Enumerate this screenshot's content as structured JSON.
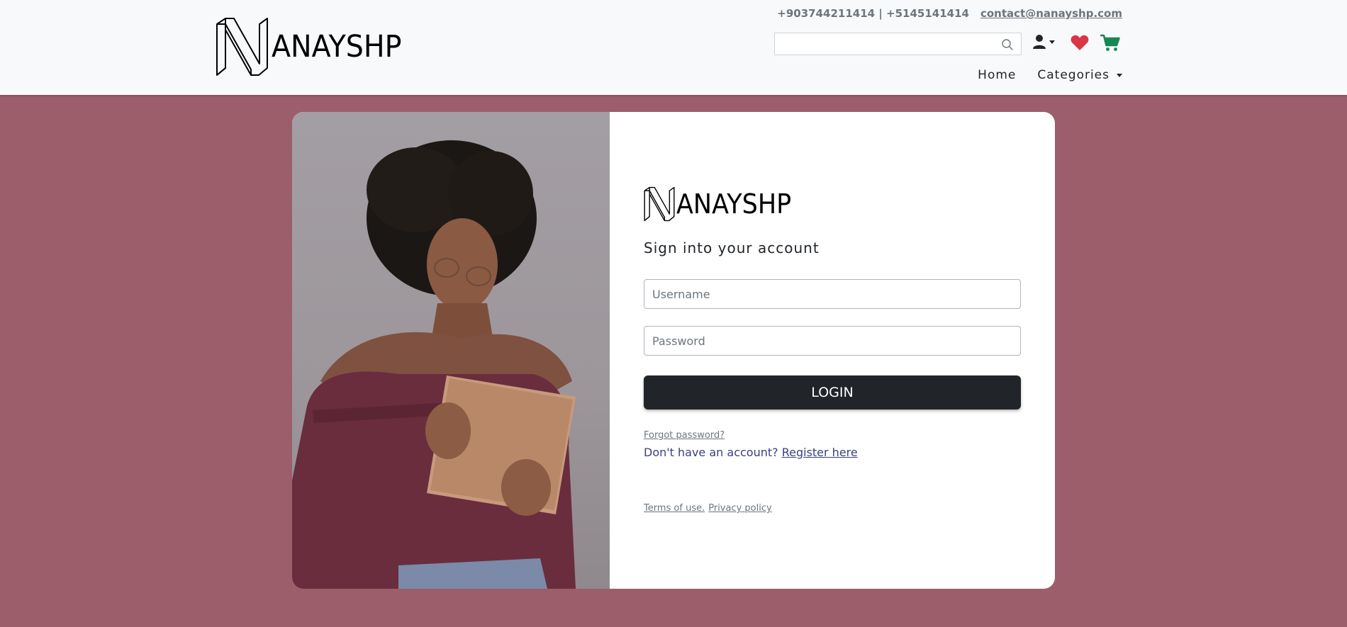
{
  "header": {
    "brand": "ANAYSHP",
    "phones": "+903744211414 | +5145141414",
    "email": "contact@nanayshp.com",
    "search_placeholder": "",
    "nav": {
      "home": "Home",
      "categories": "Categories"
    }
  },
  "login": {
    "brand": "ANAYSHP",
    "title": "Sign into your account",
    "username_placeholder": "Username",
    "password_placeholder": "Password",
    "login_button": "LOGIN",
    "forgot": "Forgot password?",
    "no_account": "Don't have an account?",
    "register": "Register here",
    "terms": "Terms of use.",
    "privacy": "Privacy policy"
  },
  "colors": {
    "page_bg": "#9c5e6a",
    "header_bg": "#f8f9fa",
    "heart": "#dc3545",
    "cart": "#198754",
    "button_bg": "#212529",
    "link": "#393f81"
  },
  "icons": {
    "search": "search-icon",
    "user": "user-icon",
    "wishlist": "heart-icon",
    "cart": "cart-icon"
  }
}
